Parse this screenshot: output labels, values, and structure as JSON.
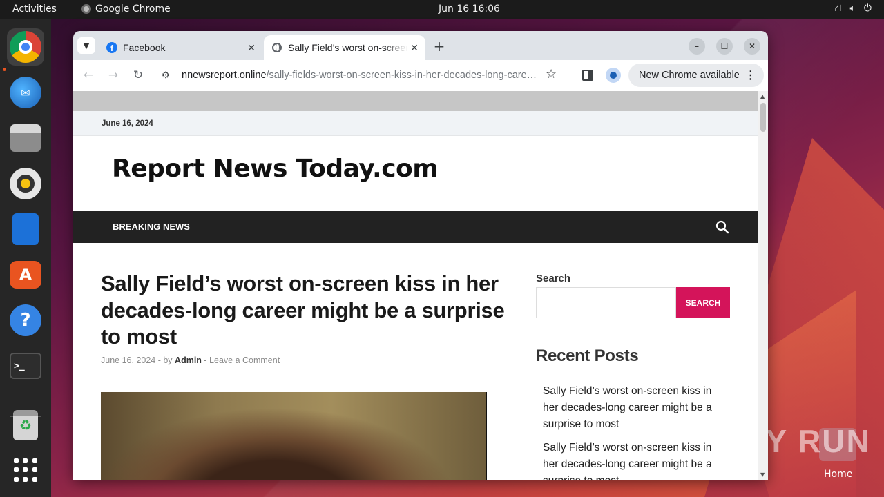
{
  "topbar": {
    "activities": "Activities",
    "app_name": "Google Chrome",
    "clock": "Jun 16  16:06",
    "status_icons": [
      "network-icon",
      "volume-icon",
      "power-icon"
    ]
  },
  "dock": {
    "items": [
      "chrome-icon",
      "thunderbird-icon",
      "files-icon",
      "rhythmbox-icon",
      "writer-icon",
      "app-center-icon",
      "help-icon",
      "terminal-icon",
      "trash-icon",
      "show-apps-icon"
    ],
    "terminal_glyph": ">_",
    "help_glyph": "?",
    "store_glyph": "A",
    "trash_glyph": "♻"
  },
  "browser": {
    "tabs": [
      {
        "title": "Facebook",
        "icon": "facebook-icon",
        "active": false
      },
      {
        "title": "Sally Field’s worst on-screen kiss in her decades-long career might be a surprise to most",
        "icon": "globe-icon",
        "active": true
      }
    ],
    "url_host": "nnewsreport.online",
    "url_path": "/sally-fields-worst-on-screen-kiss-in-her-decades-long-career-might-be-a-surprise-to-most/",
    "update_label": "New Chrome available",
    "accent": "#1a73e8"
  },
  "page": {
    "date_bar": "June 16, 2024",
    "site_title": "Report News Today.com",
    "nav_item": "BREAKING NEWS",
    "article": {
      "title": "Sally Field’s worst on-screen kiss in her decades-long career might be a surprise to most",
      "date": "June 16, 2024",
      "by": "by",
      "author": "Admin",
      "separator": " - ",
      "comment_link": "Leave a Comment"
    },
    "sidebar": {
      "search_label": "Search",
      "search_button": "SEARCH",
      "recent_heading": "Recent Posts",
      "recent_posts": [
        "Sally Field’s worst on-screen kiss in her decades-long career might be a surprise to most",
        "Sally Field’s worst on-screen kiss in her decades-long career might be a surprise to most"
      ]
    },
    "accent_color": "#d4145a"
  },
  "desktop": {
    "watermark": "ANY RUN",
    "home_label": "Home"
  }
}
